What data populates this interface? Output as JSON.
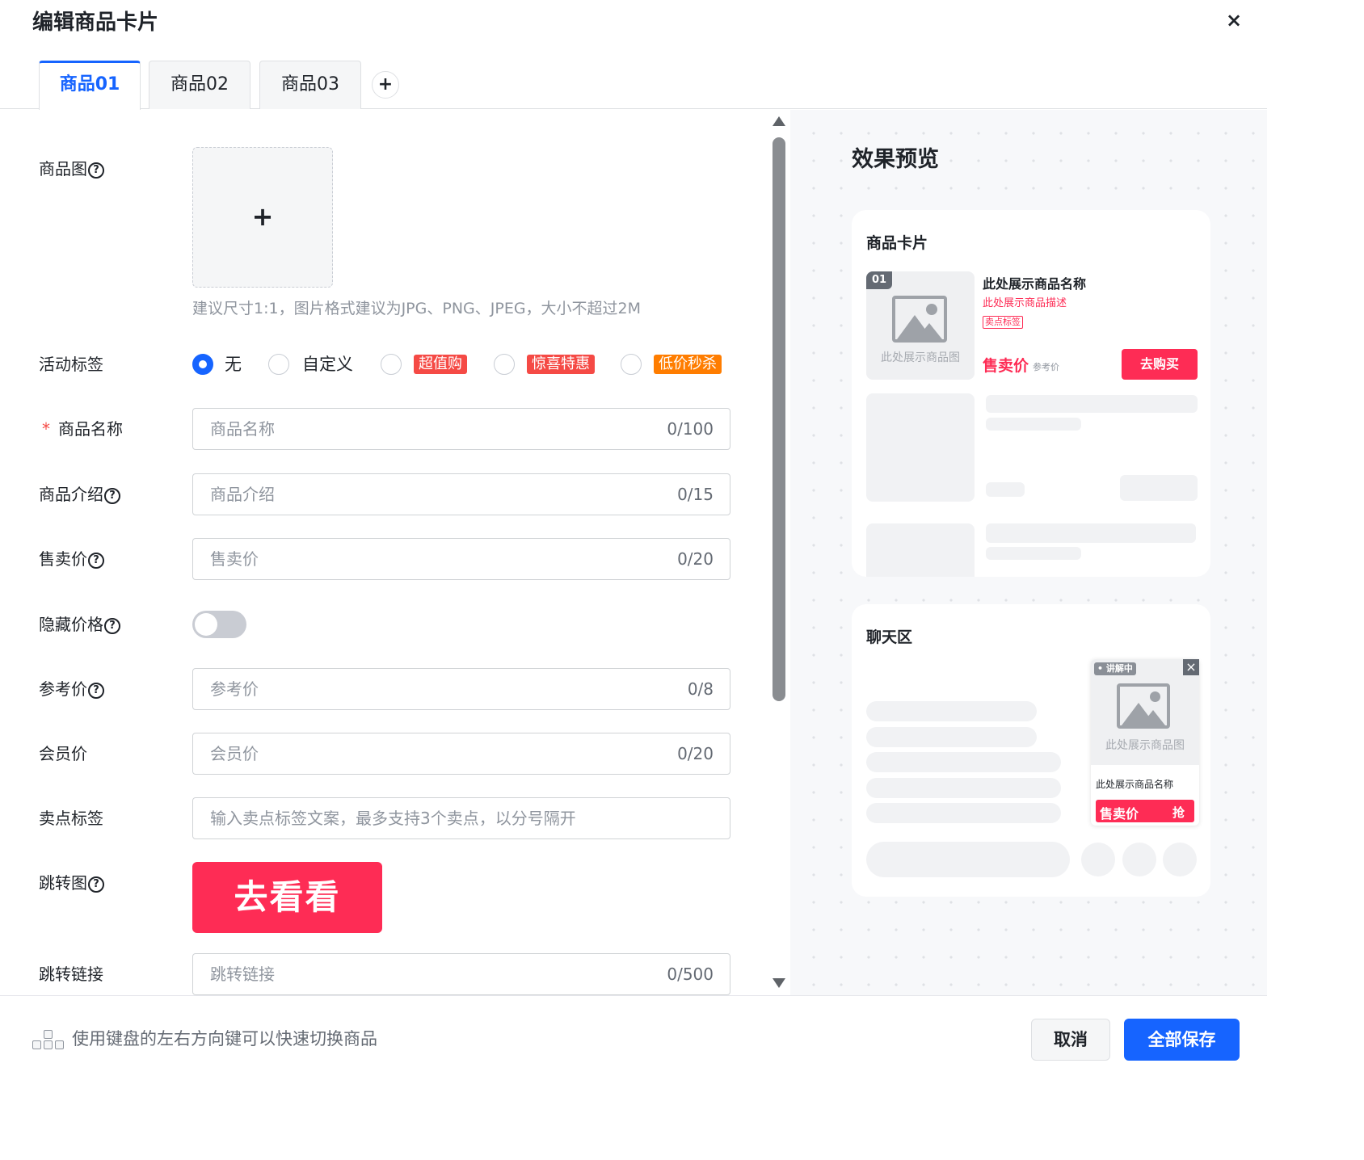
{
  "dialog": {
    "title": "编辑商品卡片",
    "close_icon": "×"
  },
  "tabs": [
    {
      "label": "商品01",
      "active": true
    },
    {
      "label": "商品02",
      "active": false
    },
    {
      "label": "商品03",
      "active": false
    }
  ],
  "tab_add_icon": "+",
  "form": {
    "image": {
      "label": "商品图",
      "upload_icon": "+",
      "hint": "建议尺寸1:1，图片格式建议为JPG、PNG、JPEG，大小不超过2M"
    },
    "activity_tag": {
      "label": "活动标签",
      "options": [
        {
          "text": "无",
          "selected": true
        },
        {
          "text": "自定义",
          "selected": false
        },
        {
          "text": "超值购",
          "chip_color": "#f54a45"
        },
        {
          "text": "惊喜特惠",
          "chip_color": "#f54a45"
        },
        {
          "text": "低价秒杀",
          "chip_color": "#ff7d00"
        }
      ]
    },
    "name": {
      "label": "商品名称",
      "required_mark": "*",
      "placeholder": "商品名称",
      "count": "0/100"
    },
    "intro": {
      "label": "商品介绍",
      "placeholder": "商品介绍",
      "count": "0/15"
    },
    "sale_price": {
      "label": "售卖价",
      "placeholder": "售卖价",
      "count": "0/20"
    },
    "hide_price": {
      "label": "隐藏价格",
      "on": false
    },
    "ref_price": {
      "label": "参考价",
      "placeholder": "参考价",
      "count": "0/8"
    },
    "member_price": {
      "label": "会员价",
      "placeholder": "会员价",
      "count": "0/20"
    },
    "selling_points": {
      "label": "卖点标签",
      "placeholder": "输入卖点标签文案，最多支持3个卖点，以分号隔开"
    },
    "jump_image": {
      "label": "跳转图",
      "button_text": "去看看"
    },
    "jump_link": {
      "label": "跳转链接",
      "placeholder": "跳转链接",
      "count": "0/500"
    }
  },
  "preview": {
    "title": "效果预览",
    "product_card": {
      "title": "商品卡片",
      "index_badge": "01",
      "image_text": "此处展示商品图",
      "name": "此处展示商品名称",
      "desc": "此处展示商品描述",
      "tag": "卖点标签",
      "price": "售卖价",
      "ref_price": "参考价",
      "buy_button": "去购买"
    },
    "chat": {
      "title": "聊天区",
      "live_badge": "• 讲解中",
      "close_icon": "×",
      "image_text": "此处展示商品图",
      "name": "此处展示商品名称",
      "price": "售卖价",
      "grab": "抢"
    }
  },
  "footer": {
    "hint": "使用键盘的左右方向键可以快速切换商品",
    "cancel": "取消",
    "save_all": "全部保存"
  },
  "colors": {
    "primary": "#1664ff",
    "brand_red": "#fe2c55",
    "danger": "#f54a45",
    "orange": "#ff7d00"
  }
}
